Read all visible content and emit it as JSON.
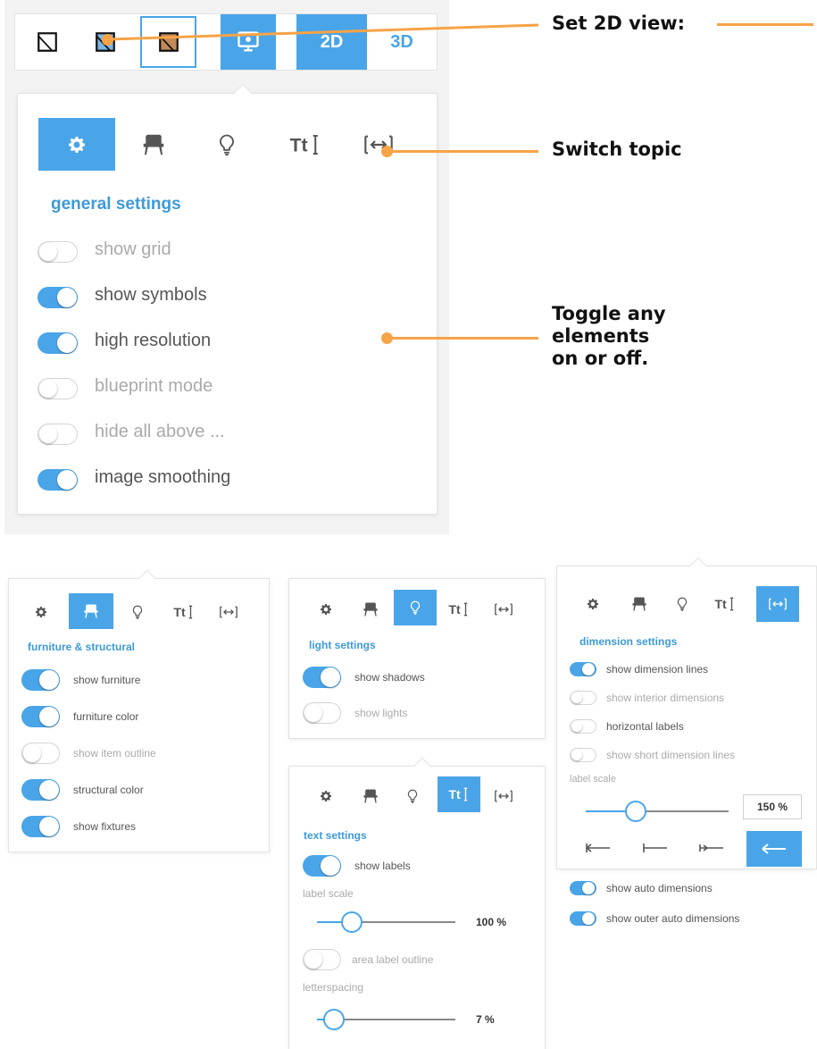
{
  "annotations": {
    "set_view": "Set 2D view:",
    "switch_topic": "Switch topic",
    "toggle_any": [
      "Toggle any",
      "elements",
      "on or off."
    ]
  },
  "view_bar": {
    "btn_2d": "2D",
    "btn_3d": "3D",
    "icons": [
      "plan-basic-icon",
      "plan-shaded-icon",
      "plan-textured-icon",
      "monitor-settings-icon"
    ]
  },
  "topic_icons": [
    "gear-icon",
    "armchair-icon",
    "bulb-icon",
    "text-icon",
    "dimension-icon"
  ],
  "main_panel": {
    "title": "general settings",
    "toggles": [
      {
        "label": "show grid",
        "on": false
      },
      {
        "label": "show symbols",
        "on": true
      },
      {
        "label": "high resolution",
        "on": true
      },
      {
        "label": "blueprint mode",
        "on": false
      },
      {
        "label": "hide all above ...",
        "on": false
      },
      {
        "label": "image smoothing",
        "on": true
      }
    ]
  },
  "furniture_panel": {
    "title": "furniture & structural",
    "toggles": [
      {
        "label": "show furniture",
        "on": true
      },
      {
        "label": "furniture color",
        "on": true
      },
      {
        "label": "show item outline",
        "on": false
      },
      {
        "label": "structural color",
        "on": true
      },
      {
        "label": "show fixtures",
        "on": true
      }
    ]
  },
  "light_panel": {
    "title": "light settings",
    "toggles": [
      {
        "label": "show shadows",
        "on": true
      },
      {
        "label": "show lights",
        "on": false
      }
    ]
  },
  "text_panel": {
    "title": "text settings",
    "show_labels": {
      "label": "show labels",
      "on": true
    },
    "label_scale_caption": "label scale",
    "label_scale_value": "100 %",
    "label_scale_fraction": 0.25,
    "area_outline": {
      "label": "area label outline",
      "on": false
    },
    "letterspacing_caption": "letterspacing",
    "letterspacing_value": "7 %",
    "letterspacing_fraction": 0.12
  },
  "dimension_panel": {
    "title": "dimension settings",
    "toggles": [
      {
        "label": "show dimension lines",
        "on": true
      },
      {
        "label": "show interior dimensions",
        "on": false
      },
      {
        "label": "horizontal labels",
        "on": false
      },
      {
        "label": "show short dimension lines",
        "on": false
      }
    ],
    "label_scale_caption": "label scale",
    "label_scale_value": "150 %",
    "label_scale_fraction": 0.35,
    "arrow_icons": [
      "arrow-start-bar-icon",
      "arrow-line-start-icon",
      "arrow-double-icon",
      "arrow-left-icon"
    ],
    "bottom_toggles": [
      {
        "label": "show auto dimensions",
        "on": true
      },
      {
        "label": "show outer auto dimensions",
        "on": true
      }
    ]
  },
  "colors": {
    "accent": "#4aa5e8",
    "annotation": "#f7a348"
  }
}
